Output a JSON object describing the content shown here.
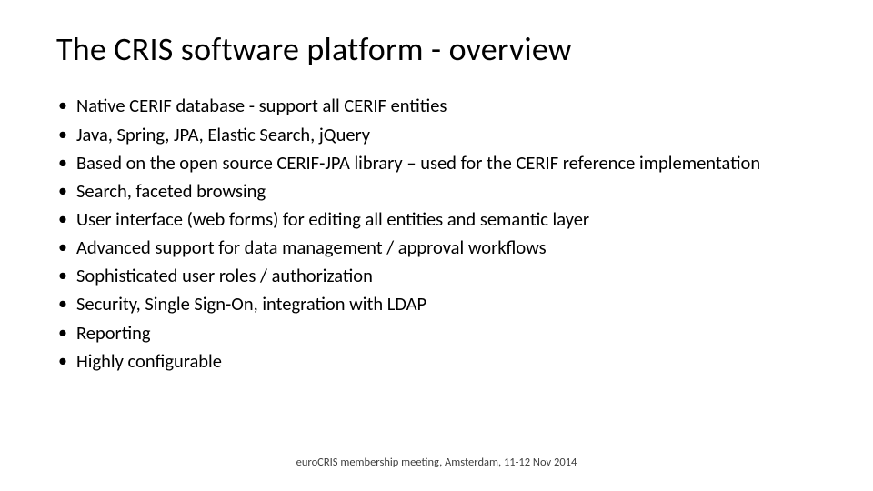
{
  "title": "The CRIS software platform - overview",
  "bullets": [
    "Native CERIF database - support all CERIF entities",
    "Java, Spring, JPA, Elastic Search, jQuery",
    "Based on the open source CERIF-JPA library – used for the CERIF reference implementation",
    "Search, faceted browsing",
    "User interface (web forms) for editing all entities and semantic layer",
    "Advanced support for data management / approval workflows",
    "Sophisticated user roles / authorization",
    "Security, Single Sign-On, integration with LDAP",
    "Reporting",
    "Highly configurable"
  ],
  "footer": "euroCRIS membership meeting, Amsterdam, 11-12 Nov 2014"
}
